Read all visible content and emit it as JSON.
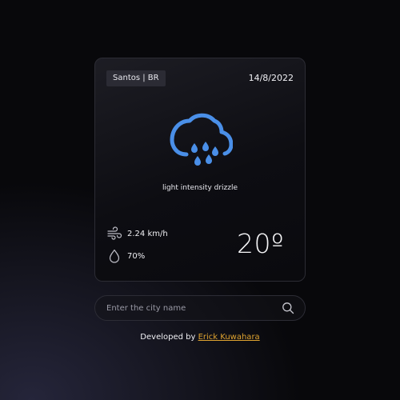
{
  "location": {
    "city_label": "Santos | BR"
  },
  "date": "14/8/2022",
  "weather": {
    "icon": "cloud-rain-icon",
    "description": "light intensity drizzle",
    "wind": {
      "icon": "wind-icon",
      "value": "2.24 km/h"
    },
    "humidity": {
      "icon": "droplet-icon",
      "value": "70%"
    },
    "temperature": "20º"
  },
  "search": {
    "placeholder": "Enter the city name",
    "value": ""
  },
  "footer": {
    "prefix": "Developed by ",
    "author_link": "Erick Kuwahara"
  },
  "colors": {
    "accent_link": "#e0a430",
    "icon_blue": "#4a8fe8"
  }
}
